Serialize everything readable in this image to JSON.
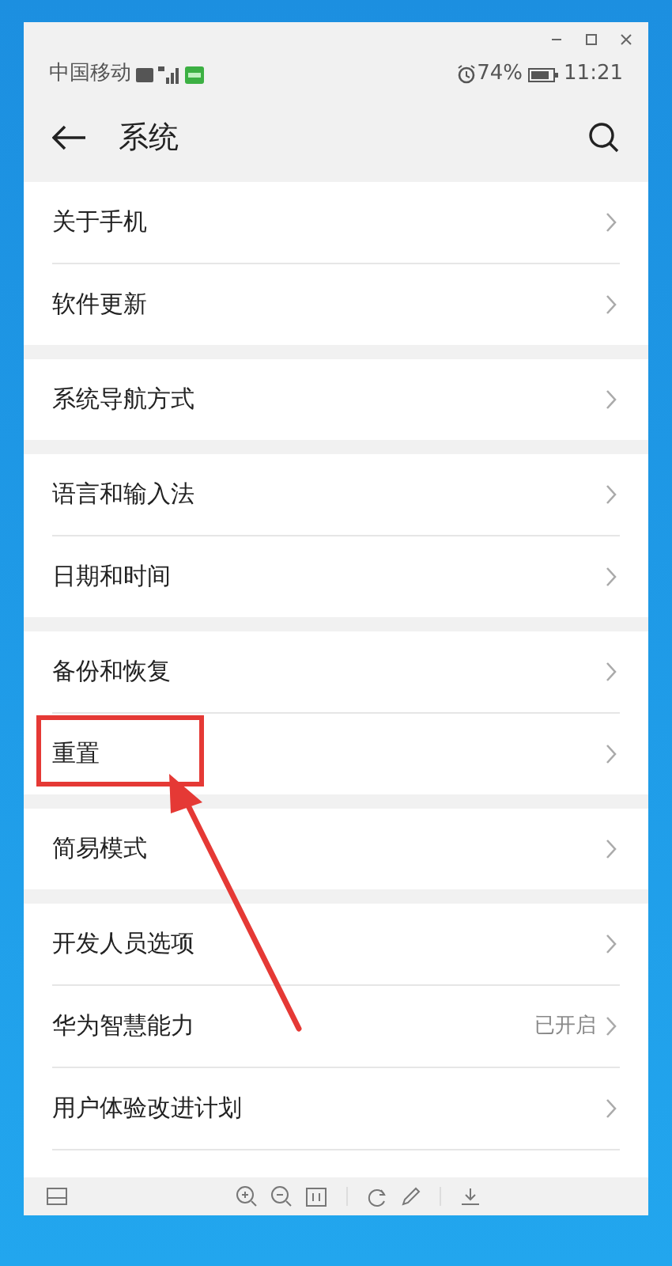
{
  "status_bar": {
    "carrier": "中国移动",
    "battery": "74%",
    "time": "11:21"
  },
  "header": {
    "title": "系统"
  },
  "groups": [
    {
      "items": [
        {
          "label": "关于手机",
          "highlighted": false
        },
        {
          "label": "软件更新",
          "highlighted": false
        }
      ]
    },
    {
      "items": [
        {
          "label": "系统导航方式",
          "highlighted": false
        }
      ]
    },
    {
      "items": [
        {
          "label": "语言和输入法",
          "highlighted": false
        },
        {
          "label": "日期和时间",
          "highlighted": false
        }
      ]
    },
    {
      "items": [
        {
          "label": "备份和恢复",
          "highlighted": false
        },
        {
          "label": "重置",
          "highlighted": true
        }
      ]
    },
    {
      "items": [
        {
          "label": "简易模式",
          "highlighted": false
        }
      ]
    },
    {
      "items": [
        {
          "label": "开发人员选项",
          "highlighted": false
        },
        {
          "label": "华为智慧能力",
          "value": "已开启",
          "highlighted": false
        },
        {
          "label": "用户体验改进计划",
          "highlighted": false
        }
      ]
    }
  ]
}
